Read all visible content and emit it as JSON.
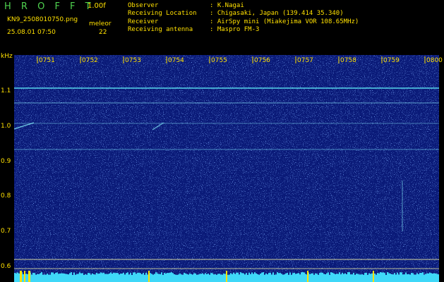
{
  "header": {
    "app_name": "H R O F F T",
    "version": "1.00f",
    "filename": "KN9_2508010750.png",
    "control": "meleor",
    "timestamp": "25.08.01 07:50",
    "counter": "22"
  },
  "info": [
    {
      "label": "Observer",
      "value": ": K.Nagai"
    },
    {
      "label": "Receiving Location",
      "value": ": Chigasaki, Japan (139.414 35.340)"
    },
    {
      "label": "Receiver",
      "value": ": AirSpy mini (Miakejima VOR 108.65MHz)"
    },
    {
      "label": "Receiving antenna",
      "value": ": Maspro FM-3"
    }
  ],
  "y_axis": {
    "unit": "kHz",
    "ticks": [
      "1.1",
      "1.0",
      "0.9",
      "0.8",
      "0.7",
      "0.6"
    ]
  },
  "x_axis": {
    "ticks": [
      "0751",
      "0752",
      "0753",
      "0754",
      "0755",
      "0756",
      "0757",
      "0758",
      "0759",
      "0800"
    ]
  },
  "colors": {
    "background": "#000000",
    "spectrogram_base": "#0a1a78",
    "text": "#ffe000",
    "title": "#4fd24f",
    "signal": "#5ae0f0"
  }
}
